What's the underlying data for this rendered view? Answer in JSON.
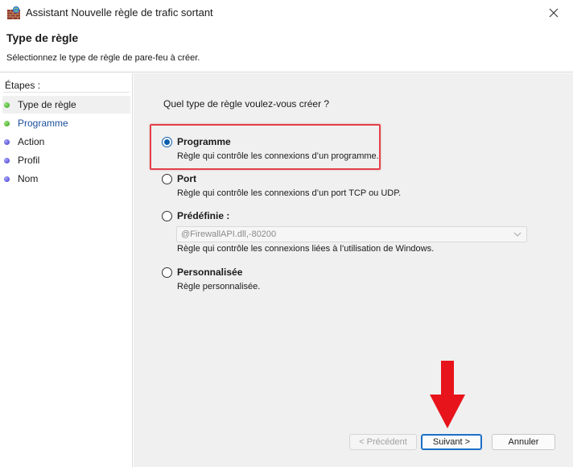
{
  "window": {
    "title": "Assistant Nouvelle règle de trafic sortant",
    "icon": "firewall-wall-icon"
  },
  "header": {
    "title": "Type de règle",
    "subtitle": "Sélectionnez le type de règle de pare-feu à créer."
  },
  "sidebar": {
    "heading": "Étapes :",
    "steps": [
      {
        "label": "Type de règle",
        "status": "done"
      },
      {
        "label": "Programme",
        "status": "current"
      },
      {
        "label": "Action",
        "status": "pending"
      },
      {
        "label": "Profil",
        "status": "pending"
      },
      {
        "label": "Nom",
        "status": "pending"
      }
    ]
  },
  "main": {
    "question": "Quel type de règle voulez-vous créer ?",
    "options": [
      {
        "title": "Programme",
        "description": "Règle qui contrôle les connexions d’un programme.",
        "selected": true
      },
      {
        "title": "Port",
        "description": "Règle qui contrôle les connexions d’un port TCP ou UDP.",
        "selected": false
      },
      {
        "title": "Prédéfinie :",
        "description": "Règle qui contrôle les connexions liées à l’utilisation de Windows.",
        "selected": false
      },
      {
        "title": "Personnalisée",
        "description": "Règle personnalisée.",
        "selected": false
      }
    ],
    "predefined_select_value": "@FirewallAPI.dll,-80200"
  },
  "buttons": {
    "previous": "< Précédent",
    "next": "Suivant >",
    "cancel": "Annuler"
  },
  "colors": {
    "highlight_border": "#e2414a",
    "arrow": "#e8141b",
    "accent": "#0b5cad",
    "done_dot": "#2f9b18",
    "pending_dot": "#3c34c4"
  }
}
